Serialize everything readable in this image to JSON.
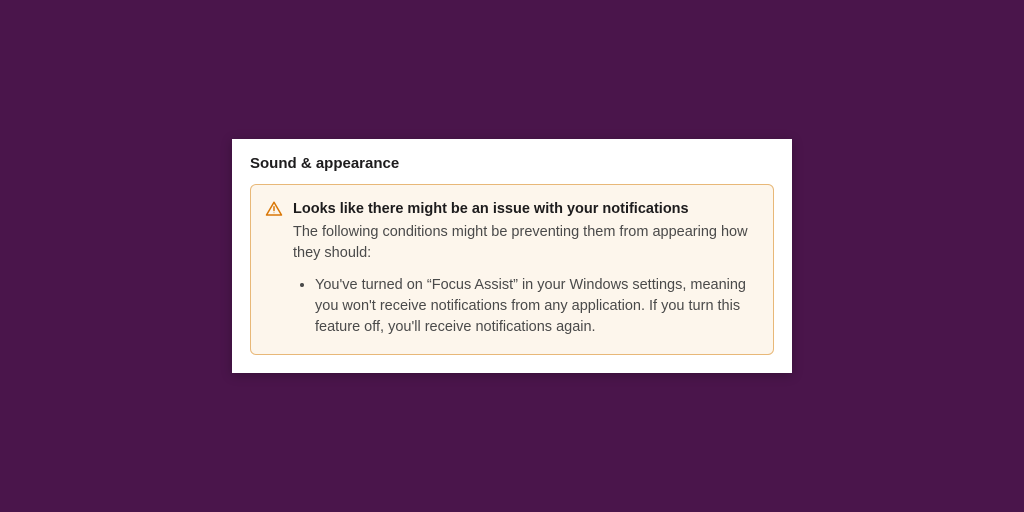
{
  "colors": {
    "background": "#4a154b",
    "panel_bg": "#ffffff",
    "alert_bg": "#fdf6ec",
    "alert_border": "#e8b878",
    "icon_stroke": "#d97706"
  },
  "panel": {
    "title": "Sound & appearance",
    "alert": {
      "icon": "warning-triangle-icon",
      "title": "Looks like there might be an issue with your notifications",
      "lead": "The following conditions might be preventing them from appearing how they should:",
      "items": [
        "You've turned on “Focus Assist” in your Windows settings, meaning you won't receive notifications from any application. If you turn this feature off, you'll receive notifications again."
      ]
    }
  }
}
